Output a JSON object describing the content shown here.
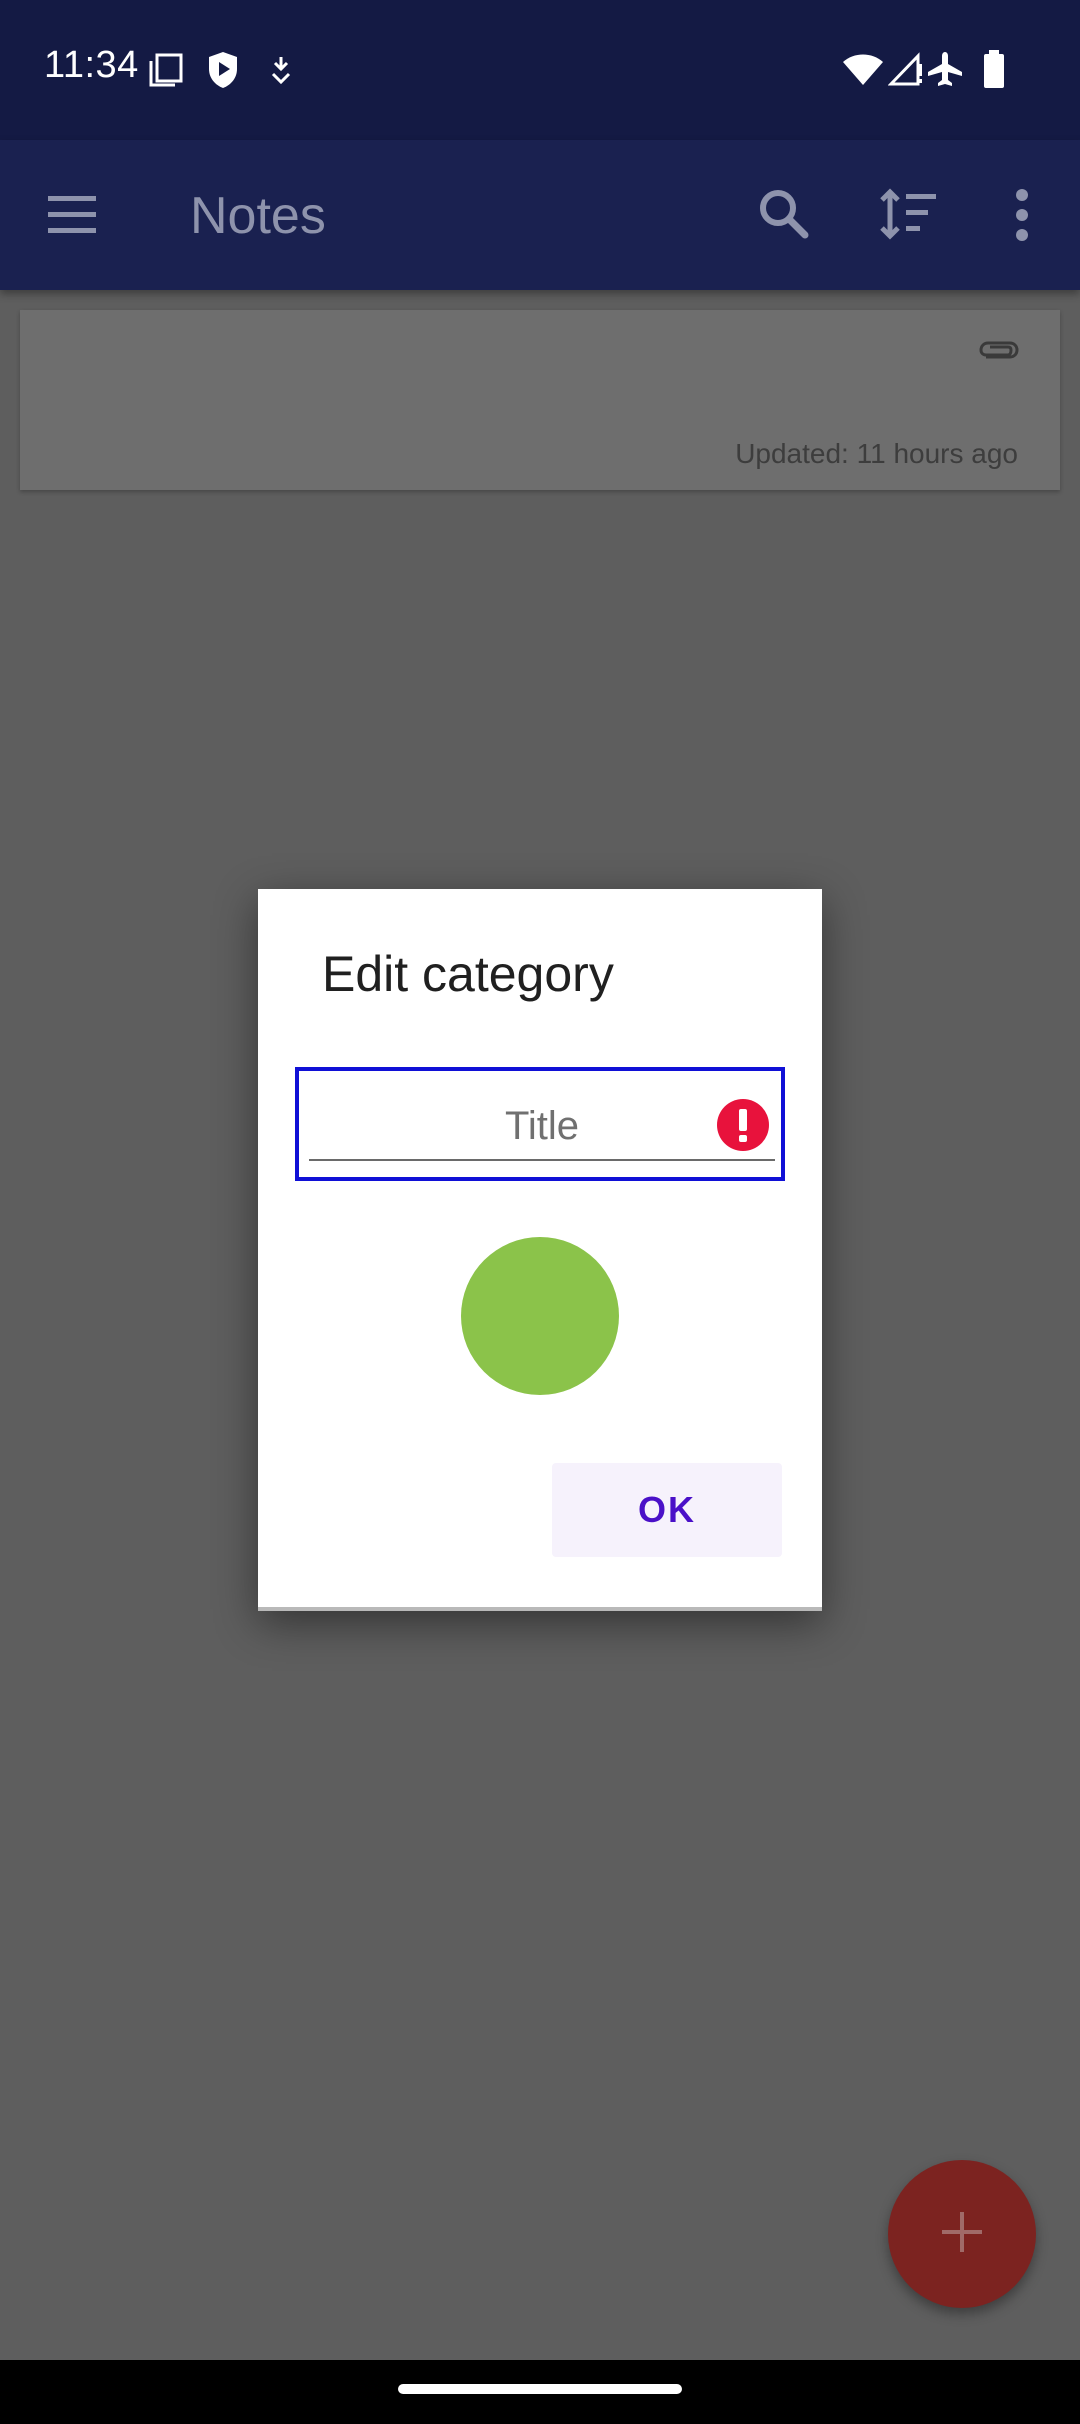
{
  "status_bar": {
    "time": "11:34",
    "icons": [
      "screenshot-icon",
      "shield-play-icon",
      "download-icon",
      "wifi-icon",
      "signal-icon",
      "airplane-icon",
      "battery-icon"
    ]
  },
  "app_bar": {
    "title": "Notes",
    "icons": [
      "menu-icon",
      "search-icon",
      "sort-icon",
      "more-vert-icon"
    ]
  },
  "notes": [
    {
      "updated": "Updated: 11 hours ago",
      "icon": "attachment-icon"
    }
  ],
  "dialog": {
    "title": "Edit category",
    "title_field": {
      "placeholder": "Title",
      "value": ""
    },
    "error_icon": "error-icon",
    "color": "#8bc34a",
    "ok_label": "OK"
  },
  "fab": {
    "icon": "plus-icon"
  },
  "colors": {
    "status_bar": "#141a44",
    "app_bar": "#1a2150",
    "scrim": "#5e5e5e",
    "fab": "#7c2320",
    "accent": "#4a10c8",
    "error": "#e8123c",
    "focus_outline": "#1010d6"
  }
}
